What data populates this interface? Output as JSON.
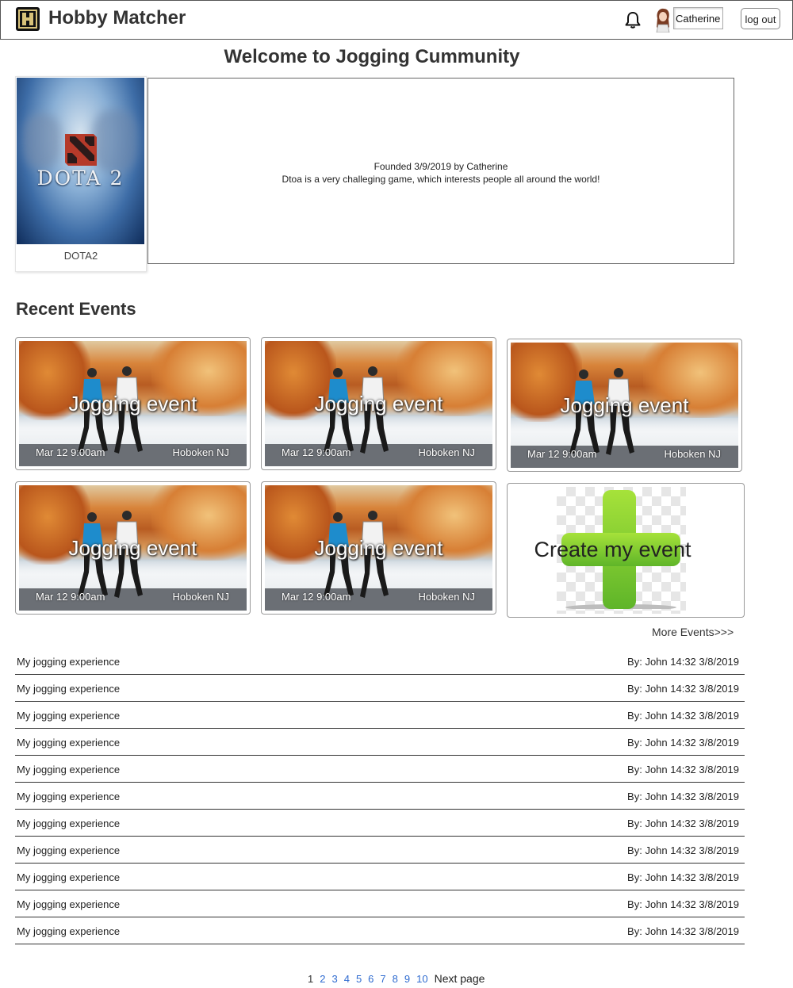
{
  "header": {
    "app_title": "Hobby Matcher",
    "user_name": "Catherine",
    "logout_label": "log out"
  },
  "welcome_title": "Welcome to Jogging Cummunity",
  "hobby": {
    "image_text": "DOTA 2",
    "name": "DOTA2",
    "founded": "Founded 3/9/2019 by Catherine",
    "description": "Dtoa is a very challeging game, which interests people all around the world!"
  },
  "recent_events": {
    "title": "Recent Events",
    "events": [
      {
        "title": "Jogging event",
        "date": "Mar 12 9:00am",
        "location": "Hoboken NJ"
      },
      {
        "title": "Jogging event",
        "date": "Mar 12 9:00am",
        "location": "Hoboken NJ"
      },
      {
        "title": "Jogging event",
        "date": "Mar 12 9:00am",
        "location": "Hoboken NJ"
      },
      {
        "title": "Jogging event",
        "date": "Mar 12 9:00am",
        "location": "Hoboken NJ"
      },
      {
        "title": "Jogging event",
        "date": "Mar 12 9:00am",
        "location": "Hoboken NJ"
      }
    ],
    "create_label": "Create my event",
    "more_label": "More Events>>>"
  },
  "posts": [
    {
      "title": "My jogging experience",
      "meta": "By: John 14:32 3/8/2019"
    },
    {
      "title": "My jogging experience",
      "meta": "By: John 14:32 3/8/2019"
    },
    {
      "title": "My jogging experience",
      "meta": "By: John 14:32 3/8/2019"
    },
    {
      "title": "My jogging experience",
      "meta": "By: John 14:32 3/8/2019"
    },
    {
      "title": "My jogging experience",
      "meta": "By: John 14:32 3/8/2019"
    },
    {
      "title": "My jogging experience",
      "meta": "By: John 14:32 3/8/2019"
    },
    {
      "title": "My jogging experience",
      "meta": "By: John 14:32 3/8/2019"
    },
    {
      "title": "My jogging experience",
      "meta": "By: John 14:32 3/8/2019"
    },
    {
      "title": "My jogging experience",
      "meta": "By: John 14:32 3/8/2019"
    },
    {
      "title": "My jogging experience",
      "meta": "By: John 14:32 3/8/2019"
    },
    {
      "title": "My jogging experience",
      "meta": "By: John 14:32 3/8/2019"
    }
  ],
  "pagination": {
    "pages": [
      "1",
      "2",
      "3",
      "4",
      "5",
      "6",
      "7",
      "8",
      "9",
      "10"
    ],
    "current": "1",
    "next_label": "Next page"
  },
  "icons": {
    "logo": "hobby-matcher-logo-icon",
    "notifications": "bell-icon",
    "user": "avatar",
    "create": "plus-icon"
  },
  "colors": {
    "link": "#2f6bd0",
    "plus_green": "#7ccd2a"
  }
}
